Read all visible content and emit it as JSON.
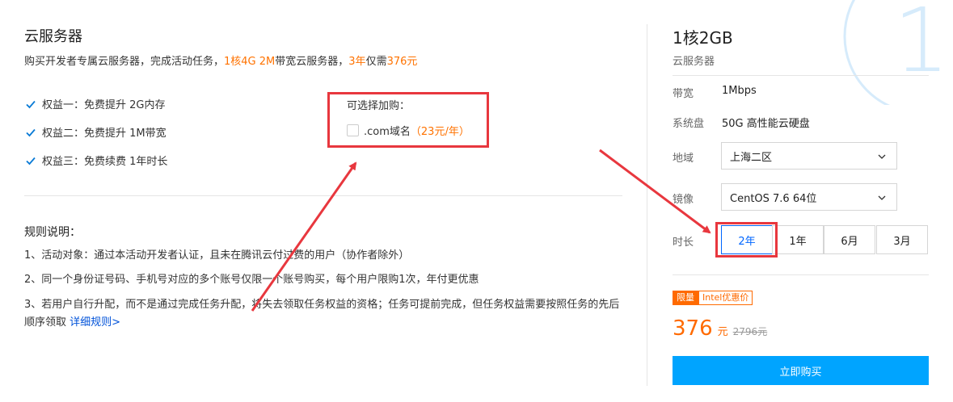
{
  "promo": {
    "title": "云服务器",
    "subtitle_prefix": "购买开发者专属云服务器，完成活动任务，",
    "subtitle_spec": "1核4G 2M",
    "subtitle_mid": "带宽云服务器，",
    "subtitle_years": "3年",
    "subtitle_mid2": "仅需",
    "subtitle_price": "376元",
    "benefits": [
      "权益一：免费提升 2G内存",
      "权益二：免费提升 1M带宽",
      "权益三：免费续费 1年时长"
    ],
    "addon": {
      "title": "可选择加购：",
      "item_label": ".com域名",
      "item_price": "（23元/年）",
      "checked": false
    },
    "rules": {
      "title": "规则说明：",
      "items": [
        "1、活动对象：通过本活动开发者认证，且未在腾讯云付过费的用户（协作者除外）",
        "2、同一个身份证号码、手机号对应的多个账号仅限一个账号购买，每个用户限购1次，年付更优惠",
        "3、若用户自行升配，而不是通过完成任务升配，将失去领取任务权益的资格；任务可提前完成，但任务权益需要按照任务的先后顺序领取 "
      ],
      "link": "详细规则>"
    }
  },
  "spec": {
    "title": "1核2GB",
    "subtitle": "云服务器",
    "bandwidth_label": "带宽",
    "bandwidth_value": "1Mbps",
    "disk_label": "系统盘",
    "disk_value": "50G 高性能云硬盘",
    "region_label": "地域",
    "region_value": "上海二区",
    "image_label": "镜像",
    "image_value": "CentOS 7.6 64位",
    "duration_label": "时长",
    "durations": [
      "2年",
      "1年",
      "6月",
      "3月"
    ],
    "selected_duration": "2年",
    "badge_limit": "限量",
    "badge_intel": "Intel优惠价",
    "price": "376",
    "price_unit": "元",
    "original_price": "2796元",
    "buy_label": "立即购买",
    "deco_digit": "1"
  },
  "colors": {
    "accent_orange": "#ff6a00",
    "primary_blue": "#00a4ff",
    "selected_blue": "#0066ff",
    "annotation_red": "#e8373e"
  }
}
